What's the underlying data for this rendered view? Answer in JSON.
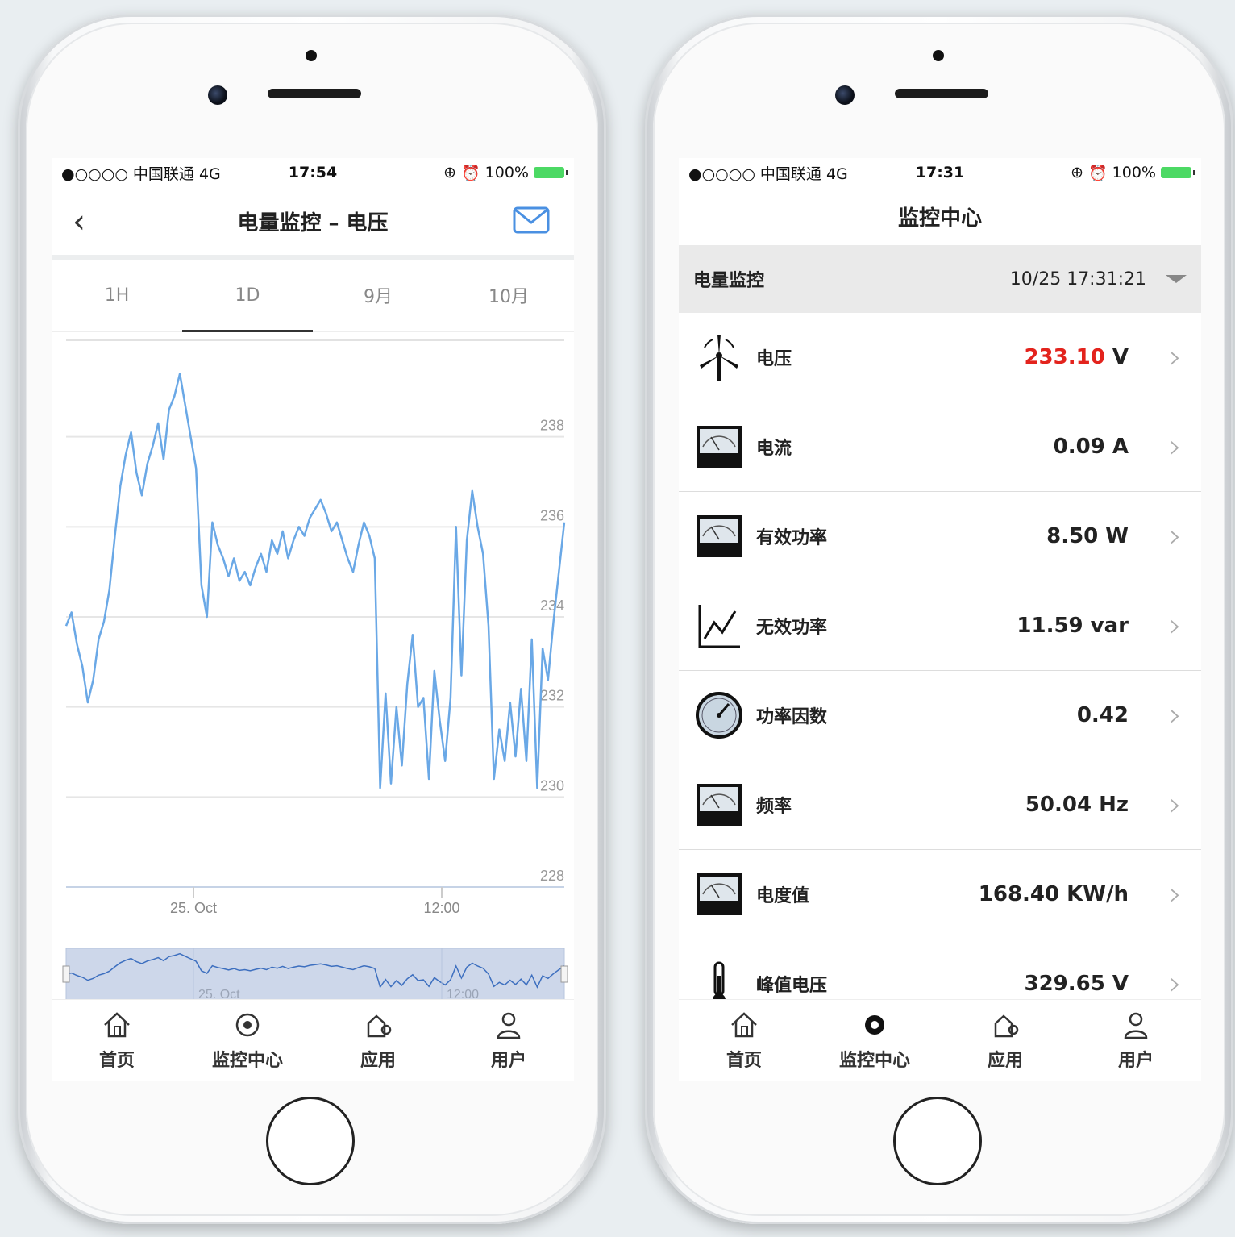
{
  "left": {
    "status": {
      "carrier": "●○○○○ 中国联通  4G",
      "time": "17:54",
      "battery": "100%"
    },
    "title": "电量监控 – 电压",
    "tabs": [
      "1H",
      "1D",
      "9月",
      "10月"
    ],
    "active_tab": "1D",
    "tabbar": [
      "首页",
      "监控中心",
      "应用",
      "用户"
    ]
  },
  "right": {
    "status": {
      "carrier": "●○○○○ 中国联通  4G",
      "time": "17:31",
      "battery": "100%"
    },
    "title": "监控中心",
    "section": {
      "label": "电量监控",
      "timestamp": "10/25 17:31:21"
    },
    "rows": [
      {
        "label": "电压",
        "value": "233.10",
        "unit": " V",
        "icon": "wind-turbine-icon",
        "highlight": true
      },
      {
        "label": "电流",
        "value": "0.09 A",
        "unit": "",
        "icon": "meter-icon"
      },
      {
        "label": "有效功率",
        "value": "8.50 W",
        "unit": "",
        "icon": "meter-icon"
      },
      {
        "label": "无效功率",
        "value": "11.59 var",
        "unit": "",
        "icon": "line-chart-icon"
      },
      {
        "label": "功率因数",
        "value": "0.42",
        "unit": "",
        "icon": "gauge-icon"
      },
      {
        "label": "频率",
        "value": "50.04 Hz",
        "unit": "",
        "icon": "meter-icon"
      },
      {
        "label": "电度值",
        "value": "168.40 KW/h",
        "unit": "",
        "icon": "meter-icon"
      },
      {
        "label": "峰值电压",
        "value": "329.65 V",
        "unit": "",
        "icon": "thermometer-icon"
      }
    ],
    "tabbar": [
      "首页",
      "监控中心",
      "应用",
      "用户"
    ]
  },
  "colors": {
    "line": "#6aa8e6",
    "accent_red": "#e3231d",
    "navigator_fill": "#cdd7ea"
  },
  "chart_data": {
    "type": "line",
    "title": "",
    "xlabel": "",
    "ylabel": "",
    "ylim": [
      228,
      240
    ],
    "yticks": [
      228,
      230,
      232,
      234,
      236,
      238
    ],
    "xticks": [
      "25. Oct",
      "12:00"
    ],
    "navigator_labels": [
      "25. Oct",
      "12:00"
    ],
    "grid": true,
    "series": [
      {
        "values": [
          233.8,
          234.1,
          233.4,
          232.9,
          232.1,
          232.6,
          233.5,
          233.9,
          234.6,
          235.8,
          236.9,
          237.6,
          238.1,
          237.2,
          236.7,
          237.4,
          237.8,
          238.3,
          237.5,
          238.6,
          238.9,
          239.4,
          238.7,
          238.0,
          237.3,
          234.7,
          234.0,
          236.1,
          235.6,
          235.3,
          234.9,
          235.3,
          234.8,
          235.0,
          234.7,
          235.1,
          235.4,
          235.0,
          235.7,
          235.4,
          235.9,
          235.3,
          235.7,
          236.0,
          235.8,
          236.2,
          236.4,
          236.6,
          236.3,
          235.9,
          236.1,
          235.7,
          235.3,
          235.0,
          235.6,
          236.1,
          235.8,
          235.3,
          230.2,
          232.3,
          230.3,
          232.0,
          230.7,
          232.5,
          233.6,
          232.0,
          232.2,
          230.4,
          232.8,
          231.7,
          230.8,
          232.2,
          236.0,
          232.7,
          235.7,
          236.8,
          236.0,
          235.4,
          233.8,
          230.4,
          231.5,
          230.8,
          232.1,
          230.9,
          232.4,
          230.8,
          233.5,
          230.2,
          233.3,
          232.6,
          233.9,
          235.0,
          236.1
        ]
      }
    ]
  }
}
